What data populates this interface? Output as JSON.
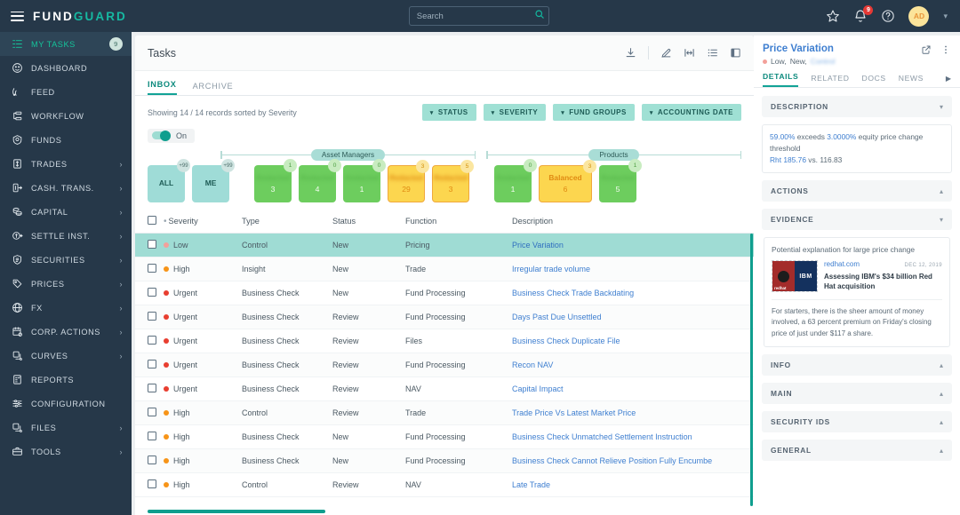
{
  "topbar": {
    "logo_a": "FUND",
    "logo_b": "GUARD",
    "search_placeholder": "Search",
    "search_value": "",
    "notification_count": "9",
    "avatar_initials": "AD"
  },
  "sidebar": {
    "items": [
      {
        "label": "MY TASKS",
        "icon": "tasks-icon",
        "count": "9",
        "chevron": false,
        "active": true
      },
      {
        "label": "DASHBOARD",
        "icon": "dashboard-icon",
        "count": "",
        "chevron": false,
        "active": false
      },
      {
        "label": "FEED",
        "icon": "feed-icon",
        "count": "",
        "chevron": false,
        "active": false
      },
      {
        "label": "WORKFLOW",
        "icon": "workflow-icon",
        "count": "",
        "chevron": false,
        "active": false
      },
      {
        "label": "FUNDS",
        "icon": "funds-icon",
        "count": "",
        "chevron": false,
        "active": false
      },
      {
        "label": "TRADES",
        "icon": "trades-icon",
        "count": "",
        "chevron": true,
        "active": false
      },
      {
        "label": "CASH. TRANS.",
        "icon": "cash-trans-icon",
        "count": "",
        "chevron": true,
        "active": false
      },
      {
        "label": "CAPITAL",
        "icon": "capital-icon",
        "count": "",
        "chevron": true,
        "active": false
      },
      {
        "label": "SETTLE INST.",
        "icon": "settle-inst-icon",
        "count": "",
        "chevron": true,
        "active": false
      },
      {
        "label": "SECURITIES",
        "icon": "securities-icon",
        "count": "",
        "chevron": true,
        "active": false
      },
      {
        "label": "PRICES",
        "icon": "prices-icon",
        "count": "",
        "chevron": true,
        "active": false
      },
      {
        "label": "FX",
        "icon": "fx-icon",
        "count": "",
        "chevron": true,
        "active": false
      },
      {
        "label": "CORP. ACTIONS",
        "icon": "corp-actions-icon",
        "count": "",
        "chevron": true,
        "active": false
      },
      {
        "label": "CURVES",
        "icon": "curves-icon",
        "count": "",
        "chevron": true,
        "active": false
      },
      {
        "label": "REPORTS",
        "icon": "reports-icon",
        "count": "",
        "chevron": false,
        "active": false
      },
      {
        "label": "CONFIGURATION",
        "icon": "configuration-icon",
        "count": "",
        "chevron": false,
        "active": false
      },
      {
        "label": "FILES",
        "icon": "files-icon",
        "count": "",
        "chevron": true,
        "active": false
      },
      {
        "label": "TOOLS",
        "icon": "tools-icon",
        "count": "",
        "chevron": true,
        "active": false
      }
    ]
  },
  "center": {
    "title": "Tasks",
    "toolbar_icons": [
      "download-icon",
      "edit-task-icon",
      "columns-icon",
      "list-view-icon",
      "card-view-icon"
    ],
    "tabs": [
      {
        "label": "INBOX",
        "active": true
      },
      {
        "label": "ARCHIVE",
        "active": false
      }
    ],
    "showing_text": "Showing 14 / 14 records sorted by Severity",
    "filters": [
      {
        "label": "STATUS"
      },
      {
        "label": "SEVERITY"
      },
      {
        "label": "FUND GROUPS"
      },
      {
        "label": "ACCOUNTING DATE"
      }
    ],
    "toggle": {
      "label": "On",
      "state": "on"
    },
    "group_rails": [
      {
        "label": "Asset Managers"
      },
      {
        "label": "Products"
      }
    ],
    "scope_chips": [
      {
        "label": "ALL",
        "badge": "+99",
        "color": "teal"
      },
      {
        "label": "ME",
        "badge": "+99",
        "color": "teal"
      }
    ],
    "asset_manager_chips": [
      {
        "label": "",
        "badge": "1",
        "value": "3",
        "color": "green",
        "blurred": true
      },
      {
        "label": "",
        "badge": "0",
        "value": "4",
        "color": "green",
        "blurred": true
      },
      {
        "label": "",
        "badge": "0",
        "value": "1",
        "color": "green",
        "blurred": true
      },
      {
        "label": "",
        "badge": "3",
        "value": "29",
        "color": "yellow",
        "blurred": true
      },
      {
        "label": "",
        "badge": "5",
        "value": "3",
        "color": "yellow",
        "blurred": true
      }
    ],
    "product_chips": [
      {
        "label": "",
        "badge": "0",
        "value": "1",
        "color": "green",
        "blurred": true
      },
      {
        "label": "Balanced",
        "badge": "3",
        "value": "6",
        "color": "yellow",
        "blurred": false
      },
      {
        "label": "",
        "badge": "1",
        "value": "5",
        "color": "green",
        "blurred": true
      }
    ],
    "table": {
      "columns": [
        "Severity",
        "Type",
        "Status",
        "Function",
        "Description"
      ],
      "rows": [
        {
          "severity": "Low",
          "sev_color": "#f3a09a",
          "type": "Control",
          "status": "New",
          "function": "Pricing",
          "description": "Price Variation",
          "selected": true
        },
        {
          "severity": "High",
          "sev_color": "#f79418",
          "type": "Insight",
          "status": "New",
          "function": "Trade",
          "description": "Irregular trade volume",
          "selected": false
        },
        {
          "severity": "Urgent",
          "sev_color": "#e83e30",
          "type": "Business Check",
          "status": "New",
          "function": "Fund Processing",
          "description": "Business Check Trade Backdating",
          "selected": false
        },
        {
          "severity": "Urgent",
          "sev_color": "#e83e30",
          "type": "Business Check",
          "status": "Review",
          "function": "Fund Processing",
          "description": "Days Past Due Unsettled",
          "selected": false
        },
        {
          "severity": "Urgent",
          "sev_color": "#e83e30",
          "type": "Business Check",
          "status": "Review",
          "function": "Files",
          "description": "Business Check Duplicate File",
          "selected": false
        },
        {
          "severity": "Urgent",
          "sev_color": "#e83e30",
          "type": "Business Check",
          "status": "Review",
          "function": "Fund Processing",
          "description": "Recon NAV",
          "selected": false
        },
        {
          "severity": "Urgent",
          "sev_color": "#e83e30",
          "type": "Business Check",
          "status": "Review",
          "function": "NAV",
          "description": "Capital Impact",
          "selected": false
        },
        {
          "severity": "High",
          "sev_color": "#f79418",
          "type": "Control",
          "status": "Review",
          "function": "Trade",
          "description": "Trade Price Vs Latest Market Price",
          "selected": false
        },
        {
          "severity": "High",
          "sev_color": "#f79418",
          "type": "Business Check",
          "status": "New",
          "function": "Fund Processing",
          "description": "Business Check Unmatched Settlement Instruction",
          "selected": false
        },
        {
          "severity": "High",
          "sev_color": "#f79418",
          "type": "Business Check",
          "status": "New",
          "function": "Fund Processing",
          "description": "Business Check Cannot Relieve Position Fully Encumbe",
          "selected": false
        },
        {
          "severity": "High",
          "sev_color": "#f79418",
          "type": "Control",
          "status": "Review",
          "function": "NAV",
          "description": "Late Trade",
          "selected": false
        }
      ]
    }
  },
  "rightpanel": {
    "title": "Price Variation",
    "subtitle_severity": "Low,",
    "subtitle_status": "New,",
    "subtitle_extra": "Control",
    "severity_color": "#f3a09a",
    "tabs": [
      {
        "label": "DETAILS",
        "active": true
      },
      {
        "label": "RELATED",
        "active": false
      },
      {
        "label": "DOCS",
        "active": false
      },
      {
        "label": "NEWS",
        "active": false
      }
    ],
    "sections": {
      "description": {
        "label": "DESCRIPTION",
        "chevron": "down",
        "line1_a": "59.00%",
        "line1_b": " exceeds ",
        "line1_c": "3.0000%",
        "line1_d": " equity price change threshold",
        "line2_a": "Rht 185.76",
        "line2_b": " vs. 116.83"
      },
      "actions": {
        "label": "ACTIONS",
        "chevron": "up"
      },
      "evidence": {
        "label": "EVIDENCE",
        "chevron": "down",
        "card_title": "Potential explanation for large price change",
        "source": "redhat.com",
        "date": "DEC 12, 2019",
        "headline": "Assessing IBM's $34 billion Red Hat acquisition",
        "thumb_left_text": "redhat",
        "thumb_right_text": "IBM",
        "body": "For starters, there is the sheer amount of money involved, a 63 percent premium on Friday's closing price of just under $117 a share."
      },
      "info": {
        "label": "INFO",
        "chevron": "up"
      },
      "main": {
        "label": "MAIN",
        "chevron": "up"
      },
      "security_ids": {
        "label": "SECURITY IDS",
        "chevron": "up"
      },
      "general": {
        "label": "GENERAL",
        "chevron": "up"
      }
    }
  }
}
